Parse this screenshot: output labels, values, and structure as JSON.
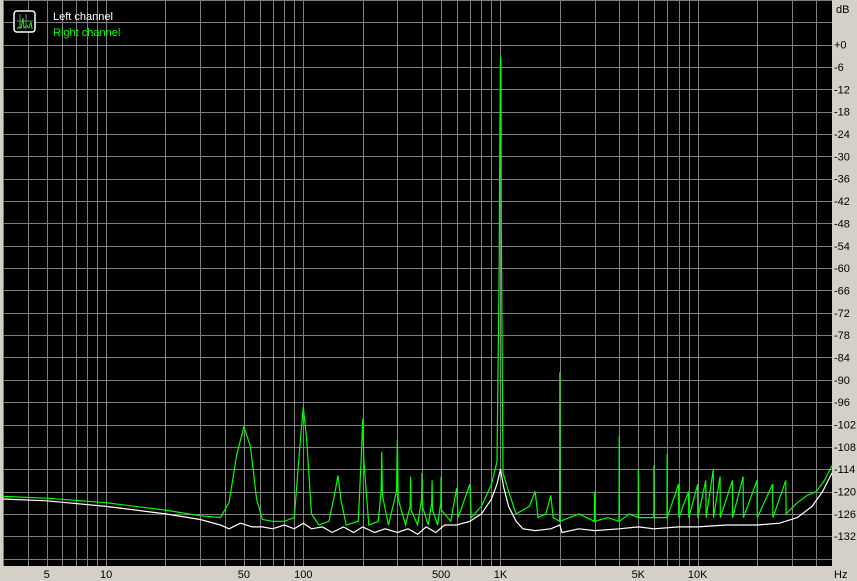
{
  "chart_data": {
    "type": "line",
    "title": "",
    "xlabel": "Hz",
    "ylabel": "dB",
    "x_scale": "log",
    "xlim": [
      3,
      48000
    ],
    "ylim": [
      -140,
      12
    ],
    "grid": true,
    "legend_placement": "top-left",
    "background": "#000000",
    "grid_color": "#808080",
    "x_tick_labels": [
      {
        "f": 5,
        "label": "5"
      },
      {
        "f": 10,
        "label": "10"
      },
      {
        "f": 50,
        "label": "50"
      },
      {
        "f": 100,
        "label": "100"
      },
      {
        "f": 500,
        "label": "500"
      },
      {
        "f": 1000,
        "label": "1K"
      },
      {
        "f": 5000,
        "label": "5K"
      },
      {
        "f": 10000,
        "label": "10K"
      }
    ],
    "y_tick_labels": [
      "+0",
      "-6",
      "-12",
      "-18",
      "-24",
      "-30",
      "-36",
      "-42",
      "-48",
      "-54",
      "-60",
      "-66",
      "-72",
      "-78",
      "-84",
      "-90",
      "-96",
      "-102",
      "-108",
      "-114",
      "-120",
      "-126",
      "-132"
    ],
    "series": [
      {
        "name": "Left channel",
        "color": "#ffffff",
        "points": [
          [
            3,
            -122
          ],
          [
            5,
            -122.5
          ],
          [
            10,
            -124
          ],
          [
            20,
            -126
          ],
          [
            30,
            -127.5
          ],
          [
            38,
            -129
          ],
          [
            42,
            -130
          ],
          [
            48,
            -128.5
          ],
          [
            55,
            -129.5
          ],
          [
            62,
            -129.5
          ],
          [
            70,
            -130
          ],
          [
            80,
            -129
          ],
          [
            90,
            -130
          ],
          [
            100,
            -128.5
          ],
          [
            110,
            -130
          ],
          [
            125,
            -129.5
          ],
          [
            140,
            -131
          ],
          [
            160,
            -129.5
          ],
          [
            180,
            -131
          ],
          [
            200,
            -129.5
          ],
          [
            230,
            -131
          ],
          [
            260,
            -130
          ],
          [
            300,
            -131
          ],
          [
            340,
            -130
          ],
          [
            380,
            -131.5
          ],
          [
            420,
            -129.5
          ],
          [
            470,
            -131
          ],
          [
            520,
            -129
          ],
          [
            600,
            -129
          ],
          [
            700,
            -128
          ],
          [
            800,
            -126
          ],
          [
            900,
            -122
          ],
          [
            960,
            -118
          ],
          [
            1000,
            -114
          ],
          [
            1040,
            -119
          ],
          [
            1100,
            -124
          ],
          [
            1200,
            -128
          ],
          [
            1300,
            -130
          ],
          [
            1500,
            -130.5
          ],
          [
            1800,
            -130
          ],
          [
            2000,
            -129
          ],
          [
            2050,
            -131
          ],
          [
            2500,
            -130
          ],
          [
            3000,
            -130.5
          ],
          [
            4000,
            -130
          ],
          [
            5000,
            -129.5
          ],
          [
            6000,
            -130
          ],
          [
            8000,
            -129.5
          ],
          [
            10000,
            -129.5
          ],
          [
            14000,
            -129
          ],
          [
            20000,
            -129
          ],
          [
            26000,
            -128.5
          ],
          [
            32000,
            -127
          ],
          [
            38000,
            -124
          ],
          [
            43000,
            -120
          ],
          [
            48000,
            -115
          ]
        ]
      },
      {
        "name": "Right channel",
        "color": "#00ff00",
        "points": [
          [
            3,
            -121.3
          ],
          [
            5,
            -121.8
          ],
          [
            10,
            -123
          ],
          [
            20,
            -125
          ],
          [
            30,
            -126.5
          ],
          [
            38,
            -127
          ],
          [
            42,
            -123
          ],
          [
            46,
            -110
          ],
          [
            50,
            -102.6
          ],
          [
            54,
            -108
          ],
          [
            58,
            -122
          ],
          [
            62,
            -127.5
          ],
          [
            70,
            -128
          ],
          [
            80,
            -128
          ],
          [
            90,
            -127
          ],
          [
            96,
            -108
          ],
          [
            100,
            -97.3
          ],
          [
            104,
            -106
          ],
          [
            110,
            -126
          ],
          [
            120,
            -129
          ],
          [
            135,
            -128
          ],
          [
            145,
            -120
          ],
          [
            150,
            -115.7
          ],
          [
            155,
            -122
          ],
          [
            165,
            -129
          ],
          [
            190,
            -128
          ],
          [
            197,
            -110
          ],
          [
            200,
            -100.5
          ],
          [
            203,
            -112
          ],
          [
            215,
            -129
          ],
          [
            240,
            -128
          ],
          [
            248,
            -120
          ],
          [
            250,
            -109.3
          ],
          [
            252,
            -121
          ],
          [
            270,
            -129
          ],
          [
            297,
            -120
          ],
          [
            300,
            -106
          ],
          [
            303,
            -122
          ],
          [
            330,
            -129
          ],
          [
            348,
            -124
          ],
          [
            350,
            -116
          ],
          [
            352,
            -125
          ],
          [
            380,
            -129
          ],
          [
            398,
            -122
          ],
          [
            400,
            -115
          ],
          [
            402,
            -124
          ],
          [
            430,
            -129
          ],
          [
            448,
            -123
          ],
          [
            450,
            -117
          ],
          [
            452,
            -125
          ],
          [
            480,
            -129
          ],
          [
            498,
            -123
          ],
          [
            500,
            -116
          ],
          [
            502,
            -125
          ],
          [
            560,
            -128
          ],
          [
            600,
            -119
          ],
          [
            610,
            -127
          ],
          [
            700,
            -118
          ],
          [
            710,
            -127
          ],
          [
            800,
            -124
          ],
          [
            900,
            -118
          ],
          [
            960,
            -112
          ],
          [
            985,
            -60
          ],
          [
            990,
            -34
          ],
          [
            1000,
            -3
          ],
          [
            1005,
            -4
          ],
          [
            1010,
            -50
          ],
          [
            1030,
            -115
          ],
          [
            1100,
            -120
          ],
          [
            1200,
            -126
          ],
          [
            1400,
            -124
          ],
          [
            1500,
            -120
          ],
          [
            1550,
            -127
          ],
          [
            1700,
            -126
          ],
          [
            1800,
            -121
          ],
          [
            1850,
            -127
          ],
          [
            1995,
            -128
          ],
          [
            2000,
            -88
          ],
          [
            2005,
            -128
          ],
          [
            2500,
            -126
          ],
          [
            2990,
            -128
          ],
          [
            3000,
            -120
          ],
          [
            3010,
            -128
          ],
          [
            3500,
            -127
          ],
          [
            3990,
            -128
          ],
          [
            4000,
            -105
          ],
          [
            4010,
            -128
          ],
          [
            4500,
            -126
          ],
          [
            4990,
            -127
          ],
          [
            5000,
            -114
          ],
          [
            5010,
            -127
          ],
          [
            5990,
            -127
          ],
          [
            6000,
            -113
          ],
          [
            6010,
            -127
          ],
          [
            6990,
            -127
          ],
          [
            7000,
            -110
          ],
          [
            7010,
            -127
          ],
          [
            8000,
            -118
          ],
          [
            8020,
            -127
          ],
          [
            9000,
            -120
          ],
          [
            9020,
            -127
          ],
          [
            10000,
            -118
          ],
          [
            10020,
            -127
          ],
          [
            11000,
            -117
          ],
          [
            11030,
            -127
          ],
          [
            12000,
            -114
          ],
          [
            12030,
            -127
          ],
          [
            13000,
            -116
          ],
          [
            13030,
            -127
          ],
          [
            15000,
            -117
          ],
          [
            15040,
            -127
          ],
          [
            17000,
            -116
          ],
          [
            17050,
            -127
          ],
          [
            20000,
            -117
          ],
          [
            20060,
            -127
          ],
          [
            24000,
            -118
          ],
          [
            24080,
            -127
          ],
          [
            28000,
            -117
          ],
          [
            28100,
            -126
          ],
          [
            32000,
            -123
          ],
          [
            36000,
            -121
          ],
          [
            40000,
            -120
          ],
          [
            44000,
            -117
          ],
          [
            48000,
            -113
          ]
        ]
      }
    ]
  }
}
